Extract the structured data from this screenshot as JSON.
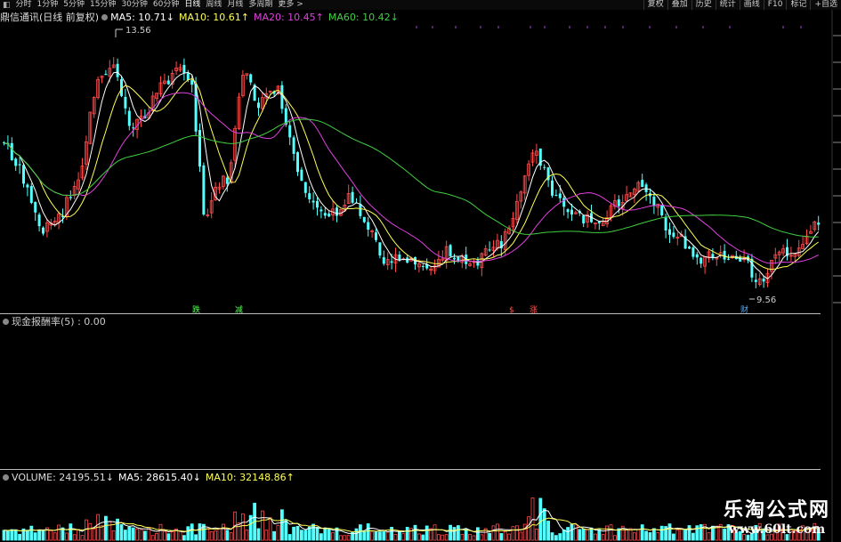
{
  "toolbar": {
    "left": [
      "分时",
      "1分钟",
      "5分钟",
      "15分钟",
      "30分钟",
      "60分钟",
      "日线",
      "周线",
      "月线",
      "多周期",
      "更多 >"
    ],
    "active": "日线",
    "right": [
      "复权",
      "叠加",
      "历史",
      "统计",
      "画线",
      "F10",
      "标记",
      "+自选"
    ]
  },
  "main_panel": {
    "stock": "鼎信通讯(日线 前复权)",
    "ma5_label": "MA5: 10.71↓",
    "ma10_label": "MA10: 10.61↑",
    "ma20_label": "MA20: 10.45↑",
    "ma60_label": "MA60: 10.42↓",
    "high_label": "13.56",
    "low_label": "9.56",
    "markers": [
      "跌",
      "减",
      "$",
      "涨",
      "财"
    ]
  },
  "indicator_panel": {
    "title": "现金报酬率(5) : 0.00"
  },
  "volume_panel": {
    "vol_label": "VOLUME: 24195.51↓",
    "ma5_label": "MA5: 28615.40↓",
    "ma10_label": "MA10: 32148.86↑"
  },
  "colors": {
    "up": "#ff4a4a",
    "down": "#54ffff",
    "ma5": "#ffffff",
    "ma10": "#ffff55",
    "ma20": "#e040e0",
    "ma60": "#40d040",
    "background": "#000000"
  },
  "watermark": {
    "line1": "乐淘公式网",
    "line2": "www.60lt.com"
  }
}
